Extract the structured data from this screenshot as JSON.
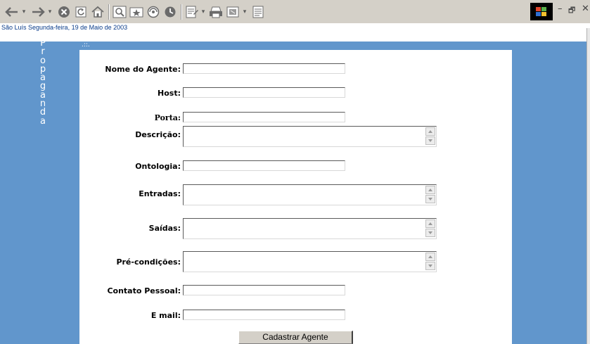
{
  "browser": {
    "toolbar_icons": [
      "back-arrow-icon",
      "forward-arrow-icon",
      "stop-icon",
      "refresh-icon",
      "home-icon",
      "search-icon",
      "favorites-icon",
      "media-icon",
      "history-icon",
      "mail-icon",
      "print-icon",
      "edit-icon",
      "discuss-icon"
    ],
    "window_controls": [
      "–",
      "🗗",
      "✕"
    ]
  },
  "date_line": "São Luís Segunda-feira, 19 de Maio de 2003",
  "sidebar": {
    "vertical_text": [
      "P",
      "r",
      "o",
      "p",
      "a",
      "g",
      "a",
      "n",
      "d",
      "a"
    ]
  },
  "panel_marker": ".::.",
  "form": {
    "fields": {
      "nome": {
        "label": "Nome do Agente:",
        "value": ""
      },
      "host": {
        "label": "Host:",
        "value": ""
      },
      "porta": {
        "label": "Porta:",
        "value": ""
      },
      "descricao": {
        "label": "Descrição:",
        "value": ""
      },
      "ontologia": {
        "label": "Ontologia:",
        "value": ""
      },
      "entradas": {
        "label": "Entradas:",
        "value": ""
      },
      "saidas": {
        "label": "Saídas:",
        "value": ""
      },
      "precondicoes": {
        "label": "Pré-condições:",
        "value": ""
      },
      "contato": {
        "label": "Contato Pessoal:",
        "value": ""
      },
      "email": {
        "label": "E mail:",
        "value": ""
      }
    },
    "submit_label": "Cadastrar Agente"
  },
  "colors": {
    "page_background": "#6196cc",
    "date_text": "#0a3c8a",
    "toolbar": "#d4d0c8"
  }
}
